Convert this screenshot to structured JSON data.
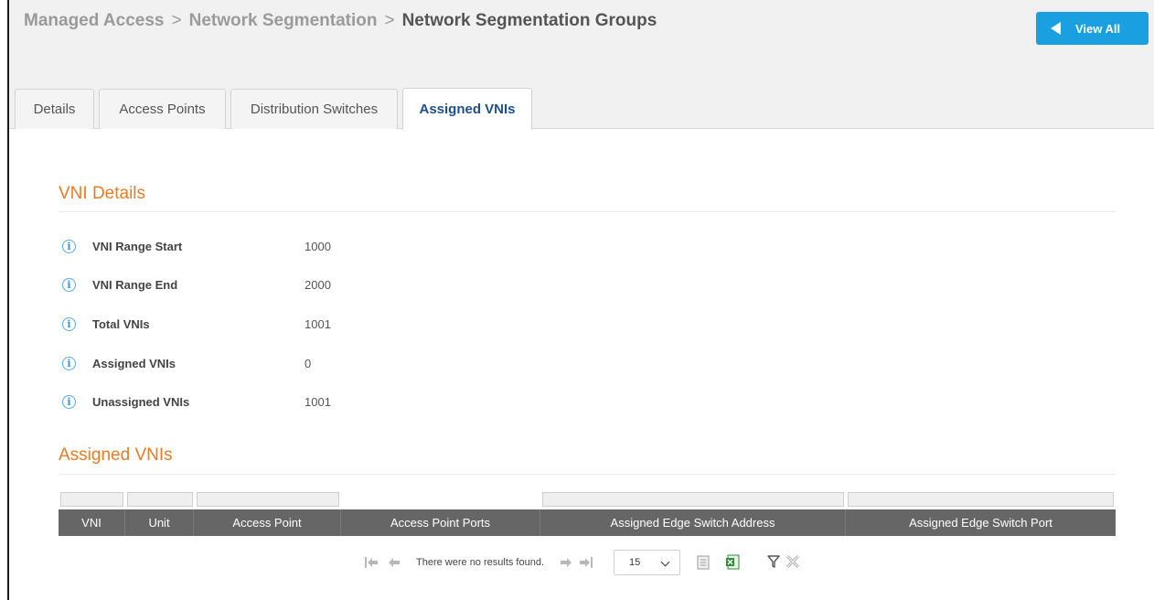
{
  "breadcrumb": {
    "items": [
      "Managed Access",
      "Network Segmentation"
    ],
    "separator": ">",
    "current": "Network Segmentation Groups"
  },
  "header": {
    "view_all_label": "View All"
  },
  "tabs": [
    {
      "label": "Details",
      "active": false
    },
    {
      "label": "Access Points",
      "active": false
    },
    {
      "label": "Distribution Switches",
      "active": false
    },
    {
      "label": "Assigned VNIs",
      "active": true
    }
  ],
  "vni_details": {
    "title": "VNI Details",
    "info_glyph": "i",
    "rows": [
      {
        "label": "VNI Range Start",
        "value": "1000"
      },
      {
        "label": "VNI Range End",
        "value": "2000"
      },
      {
        "label": "Total VNIs",
        "value": "1001"
      },
      {
        "label": "Assigned VNIs",
        "value": "0"
      },
      {
        "label": "Unassigned VNIs",
        "value": "1001"
      }
    ]
  },
  "assigned_vnis": {
    "title": "Assigned VNIs",
    "columns": [
      "VNI",
      "Unit",
      "Access Point",
      "Access Point Ports",
      "Assigned Edge Switch Address",
      "Assigned Edge Switch Port"
    ],
    "rows": []
  },
  "pager": {
    "message": "There were no results found.",
    "page_size": "15",
    "icons": [
      "first-page-icon",
      "prev-page-icon",
      "next-page-icon",
      "last-page-icon",
      "csv-export-icon",
      "excel-export-icon",
      "filter-icon",
      "clear-filter-icon"
    ]
  },
  "colors": {
    "accent_orange": "#ea7b23",
    "button_blue": "#1a9fe0",
    "active_tab_text": "#1f4f8b",
    "grid_header": "#666666",
    "info_icon": "#5aa8e6",
    "excel_green": "#2e8b3a"
  }
}
